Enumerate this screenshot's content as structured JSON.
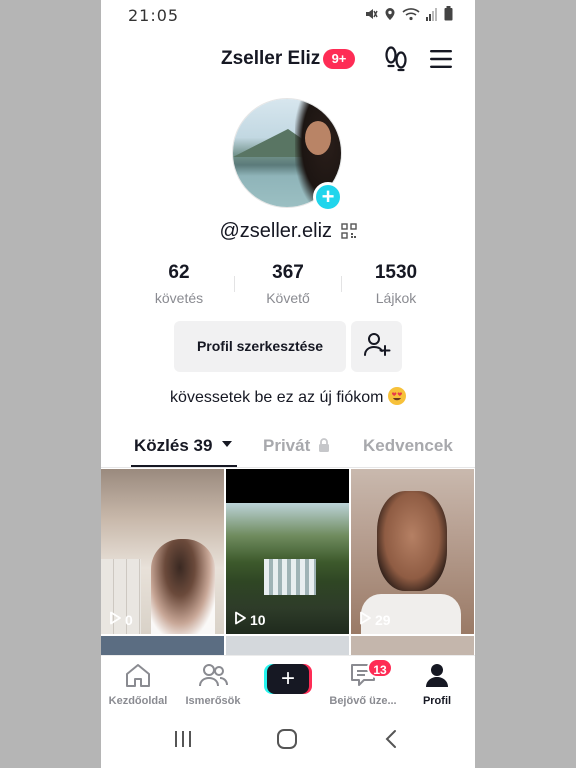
{
  "status_bar": {
    "time": "21:05",
    "icons": [
      "mute-icon",
      "location-icon",
      "wifi-icon",
      "signal-icon",
      "battery-icon"
    ]
  },
  "header": {
    "title": "Zseller Eliz",
    "notification_badge": "9+",
    "icons": [
      "footprints-icon",
      "menu-icon"
    ]
  },
  "profile": {
    "handle": "@zseller.eliz",
    "bio": "kövessetek be ez az új fiókom",
    "stats": [
      {
        "value": "62",
        "label": "követés"
      },
      {
        "value": "367",
        "label": "Követő"
      },
      {
        "value": "1530",
        "label": "Lájkok"
      }
    ],
    "edit_button": "Profil szerkesztése",
    "add_friend_icon": "add-friend-icon"
  },
  "tabs": {
    "posts": "Közlés 39",
    "private": "Privát",
    "favorites": "Kedvencek",
    "active": "posts"
  },
  "videos": [
    {
      "views": "0"
    },
    {
      "views": "10"
    },
    {
      "views": "29"
    }
  ],
  "bottom_nav": {
    "items": [
      {
        "label": "Kezdőoldal",
        "icon": "home-icon"
      },
      {
        "label": "Ismerősök",
        "icon": "friends-icon"
      },
      {
        "label": "",
        "icon": "plus-icon"
      },
      {
        "label": "Bejövő üze...",
        "icon": "inbox-icon"
      },
      {
        "label": "Profil",
        "icon": "profile-icon"
      }
    ],
    "inbox_badge": "13",
    "active": "Profil"
  },
  "colors": {
    "accent_red": "#fe2c55",
    "accent_cyan": "#20d5ec",
    "text_primary": "#161823",
    "text_secondary": "#8a8b91"
  }
}
